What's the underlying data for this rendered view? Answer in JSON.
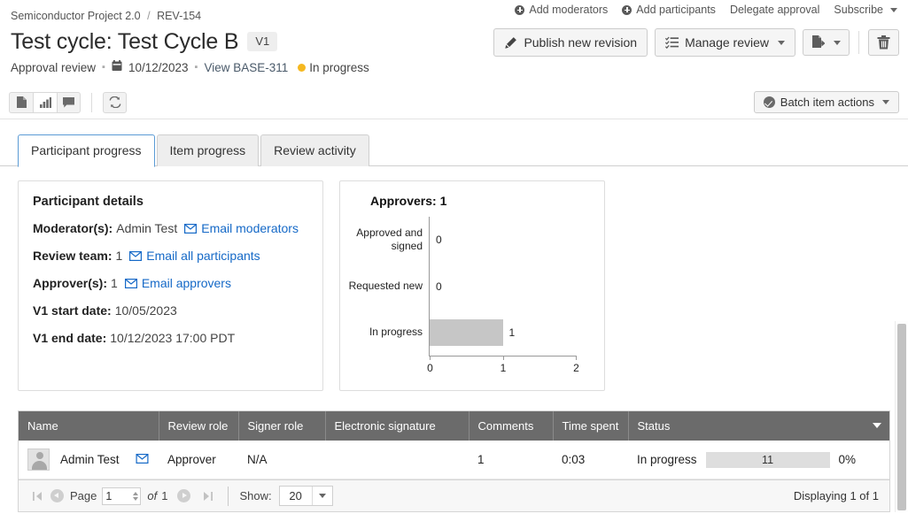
{
  "breadcrumb": {
    "project": "Semiconductor Project 2.0",
    "separator": "/",
    "item": "REV-154"
  },
  "header": {
    "title": "Test cycle: Test Cycle B",
    "version_badge": "V1",
    "review_type": "Approval review",
    "due_date": "10/12/2023",
    "view_link": "View BASE-311",
    "status": "In progress",
    "status_color": "#f5b820",
    "links": [
      {
        "label": "Add moderators",
        "icon": "plus-circle-icon"
      },
      {
        "label": "Add participants",
        "icon": "plus-circle-icon"
      },
      {
        "label": "Delegate approval",
        "icon": ""
      },
      {
        "label": "Subscribe",
        "icon": "caret-down-icon"
      }
    ],
    "buttons": {
      "publish": "Publish new revision",
      "manage": "Manage review",
      "export_icon": "export-icon",
      "delete_icon": "trash-icon"
    }
  },
  "toolbar": {
    "view_icons": [
      "document-icon",
      "chart-bar-icon",
      "comment-icon"
    ],
    "active_view": "chart-bar-icon",
    "refresh_icon": "refresh-icon",
    "batch_actions": "Batch item actions"
  },
  "tabs": [
    {
      "label": "Participant progress",
      "active": true
    },
    {
      "label": "Item progress",
      "active": false
    },
    {
      "label": "Review activity",
      "active": false
    }
  ],
  "participant_details": {
    "title": "Participant details",
    "rows": [
      {
        "label": "Moderator(s):",
        "value": "Admin Test",
        "link": "Email moderators"
      },
      {
        "label": "Review team:",
        "value": "1",
        "link": "Email all participants"
      },
      {
        "label": "Approver(s):",
        "value": "1",
        "link": "Email approvers"
      },
      {
        "label": "V1 start date:",
        "value": "10/05/2023",
        "link": ""
      },
      {
        "label": "V1 end date:",
        "value": "10/12/2023 17:00 PDT",
        "link": ""
      }
    ]
  },
  "chart_data": {
    "type": "bar",
    "orientation": "horizontal",
    "title": "Approvers: 1",
    "categories": [
      "Approved and signed",
      "Requested new",
      "In progress"
    ],
    "values": [
      0,
      0,
      1
    ],
    "data_labels": [
      "0",
      "0",
      "1"
    ],
    "xlabel": "",
    "ylabel": "",
    "xlim": [
      0,
      2
    ],
    "xticks": [
      0,
      1,
      2
    ],
    "xtick_labels": [
      "0",
      "1",
      "2"
    ],
    "grid": false,
    "legend": false,
    "bar_color": "#c6c6c6"
  },
  "table": {
    "columns": [
      "Name",
      "Review role",
      "Signer role",
      "Electronic signature",
      "Comments",
      "Time spent",
      "Status"
    ],
    "rows": [
      {
        "name": "Admin Test",
        "email_icon": "envelope-icon",
        "review_role": "Approver",
        "signer_role": "N/A",
        "electronic_signature": "",
        "comments": "1",
        "time_spent": "0:03",
        "status": "In progress",
        "progress_label": "11",
        "progress_percent": "0%",
        "progress_value": 0
      }
    ]
  },
  "pager": {
    "page_label": "Page",
    "page_value": "1",
    "of_label": "of",
    "total_pages": "1",
    "show_label": "Show:",
    "show_value": "20",
    "displaying": "Displaying 1 of 1"
  }
}
